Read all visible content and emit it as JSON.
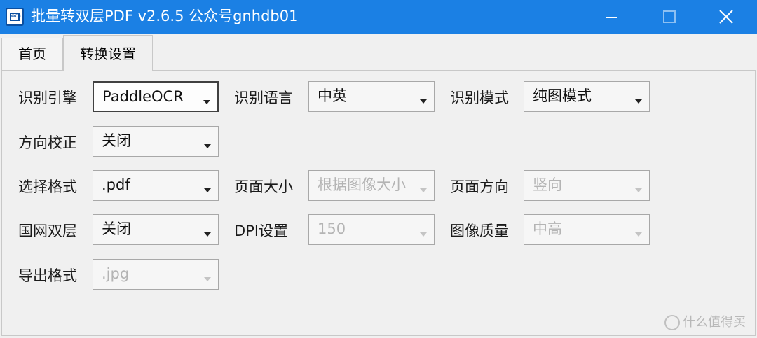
{
  "window": {
    "title": "批量转双层PDF v2.6.5 公众号gnhdb01",
    "icon_text": "OCR"
  },
  "tabs": [
    {
      "label": "首页",
      "selected": false
    },
    {
      "label": "转换设置",
      "selected": true
    }
  ],
  "settings": {
    "ocr_engine": {
      "label": "识别引擎",
      "value": "PaddleOCR"
    },
    "ocr_language": {
      "label": "识别语言",
      "value": "中英"
    },
    "ocr_mode": {
      "label": "识别模式",
      "value": "纯图模式"
    },
    "orientation_fix": {
      "label": "方向校正",
      "value": "关闭"
    },
    "select_format": {
      "label": "选择格式",
      "value": ".pdf"
    },
    "page_size": {
      "label": "页面大小",
      "value": "根据图像大小"
    },
    "page_orientation": {
      "label": "页面方向",
      "value": "竖向"
    },
    "gov_dual_layer": {
      "label": "国网双层",
      "value": "关闭"
    },
    "dpi": {
      "label": "DPI设置",
      "value": "150"
    },
    "image_quality": {
      "label": "图像质量",
      "value": "中高"
    },
    "export_format": {
      "label": "导出格式",
      "value": ".jpg"
    }
  },
  "watermark": {
    "text": "什么值得买"
  },
  "colors": {
    "titlebar": "#1b80e4",
    "disabled_text": "#b4b4b4"
  }
}
